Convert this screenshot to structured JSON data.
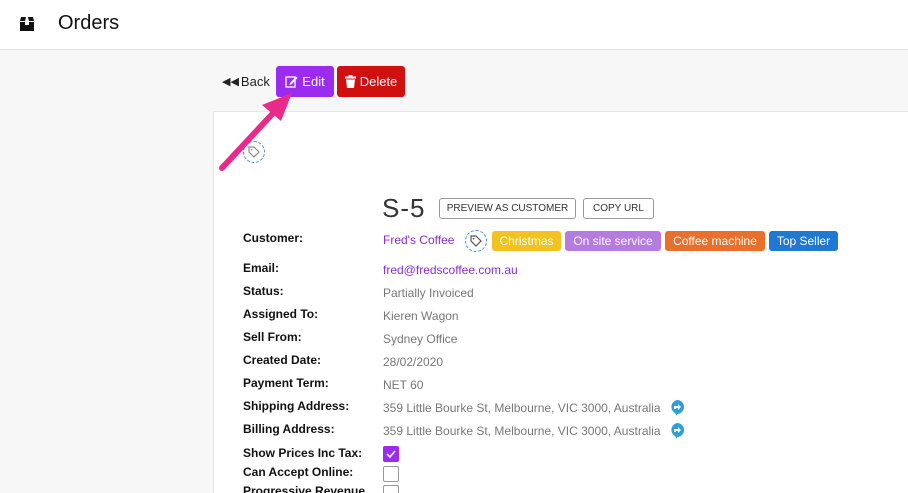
{
  "header": {
    "title": "Orders",
    "icon": "box-icon"
  },
  "actions": {
    "back_label": "Back",
    "edit_label": "Edit",
    "delete_label": "Delete"
  },
  "order": {
    "number": "S-5",
    "preview_label": "PREVIEW AS CUSTOMER",
    "copy_label": "COPY URL"
  },
  "fields": {
    "customer_label": "Customer:",
    "customer_value": "Fred's Coffee",
    "email_label": "Email:",
    "email_value": "fred@fredscoffee.com.au",
    "status_label": "Status:",
    "status_value": "Partially Invoiced",
    "assigned_label": "Assigned To:",
    "assigned_value": "Kieren Wagon",
    "sellfrom_label": "Sell From:",
    "sellfrom_value": "Sydney Office",
    "created_label": "Created Date:",
    "created_value": "28/02/2020",
    "term_label": "Payment Term:",
    "term_value": "NET 60",
    "shipping_label": "Shipping Address:",
    "shipping_value": "359 Little Bourke St, Melbourne, VIC 3000, Australia",
    "billing_label": "Billing Address:",
    "billing_value": "359 Little Bourke St, Melbourne, VIC 3000, Australia",
    "showprices_label": "Show Prices Inc Tax:",
    "showprices_checked": true,
    "acceptonline_label": "Can Accept Online:",
    "acceptonline_checked": false,
    "progressive_label": "Progressive Revenue",
    "progressive_checked": false
  },
  "tags": [
    {
      "label": "Christmas",
      "color": "#f2c31f"
    },
    {
      "label": "On site service",
      "color": "#b57be0"
    },
    {
      "label": "Coffee machine",
      "color": "#e96f2a"
    },
    {
      "label": "Top Seller",
      "color": "#1f78d1"
    }
  ],
  "colors": {
    "accent": "#9b2bee",
    "danger": "#d00f0f",
    "arrow": "#ea2a8a",
    "link": "#8a2bd6"
  }
}
